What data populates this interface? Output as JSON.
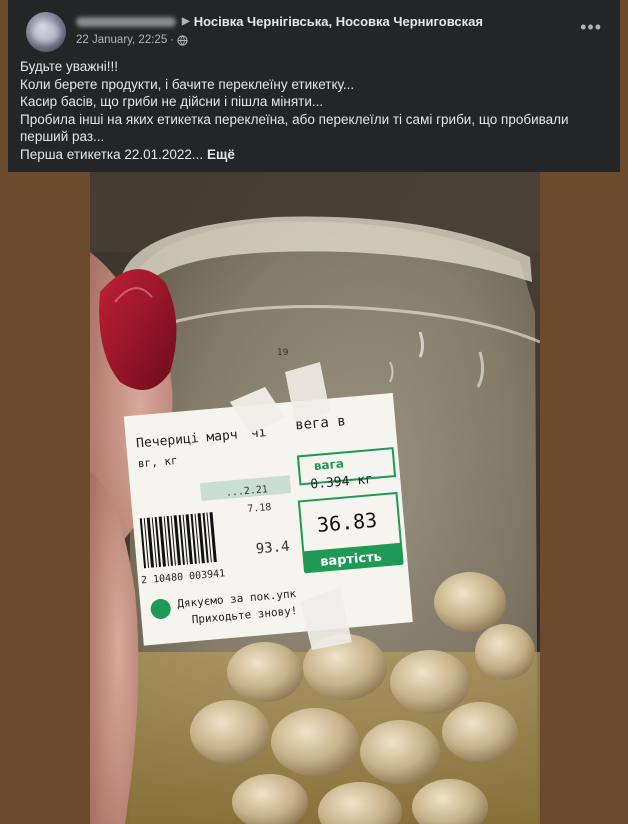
{
  "post": {
    "group_name": "Носівка Чернігівська, Носовка Черниговская",
    "date": "22 January, 22:25",
    "date_separator": "·",
    "more_icon": "more-horizontal-icon",
    "audience_icon": "globe-icon",
    "text_lines": [
      "Будьте уважні!!!",
      "Коли берете продукти, і бачите переклеїну етикетку...",
      "Касир басів, що гриби не дійсни і пішла міняти...",
      "Пробила інші  на яких етикетка переклеїна, або переклеїли ті самі гриби, що пробивали",
      "перший раз..."
    ],
    "last_line": "Перша етикетка 22.01.2022...",
    "see_more": "Ещё"
  },
  "photo": {
    "label": {
      "product": "Печерицi марч",
      "product_suffix": "чi",
      "weight_word_prefix": "вега в",
      "unit": "вг, кг",
      "date1": "...2.21",
      "date2": "7.18",
      "weight_label": "вага",
      "weight_value": "0.394 кг",
      "price_per_kg": "93.4",
      "total": "36.83",
      "total_label": "вартість",
      "barcode": "2 10480 003941",
      "thanks1": "Дякуємо за пок.упк",
      "thanks2": "Приходьте знову!",
      "stamp_partial": "19"
    },
    "colors": {
      "brown_bg": "#6b4a2e",
      "label_green": "#1e9a56",
      "nail_red": "#9c1426"
    }
  }
}
